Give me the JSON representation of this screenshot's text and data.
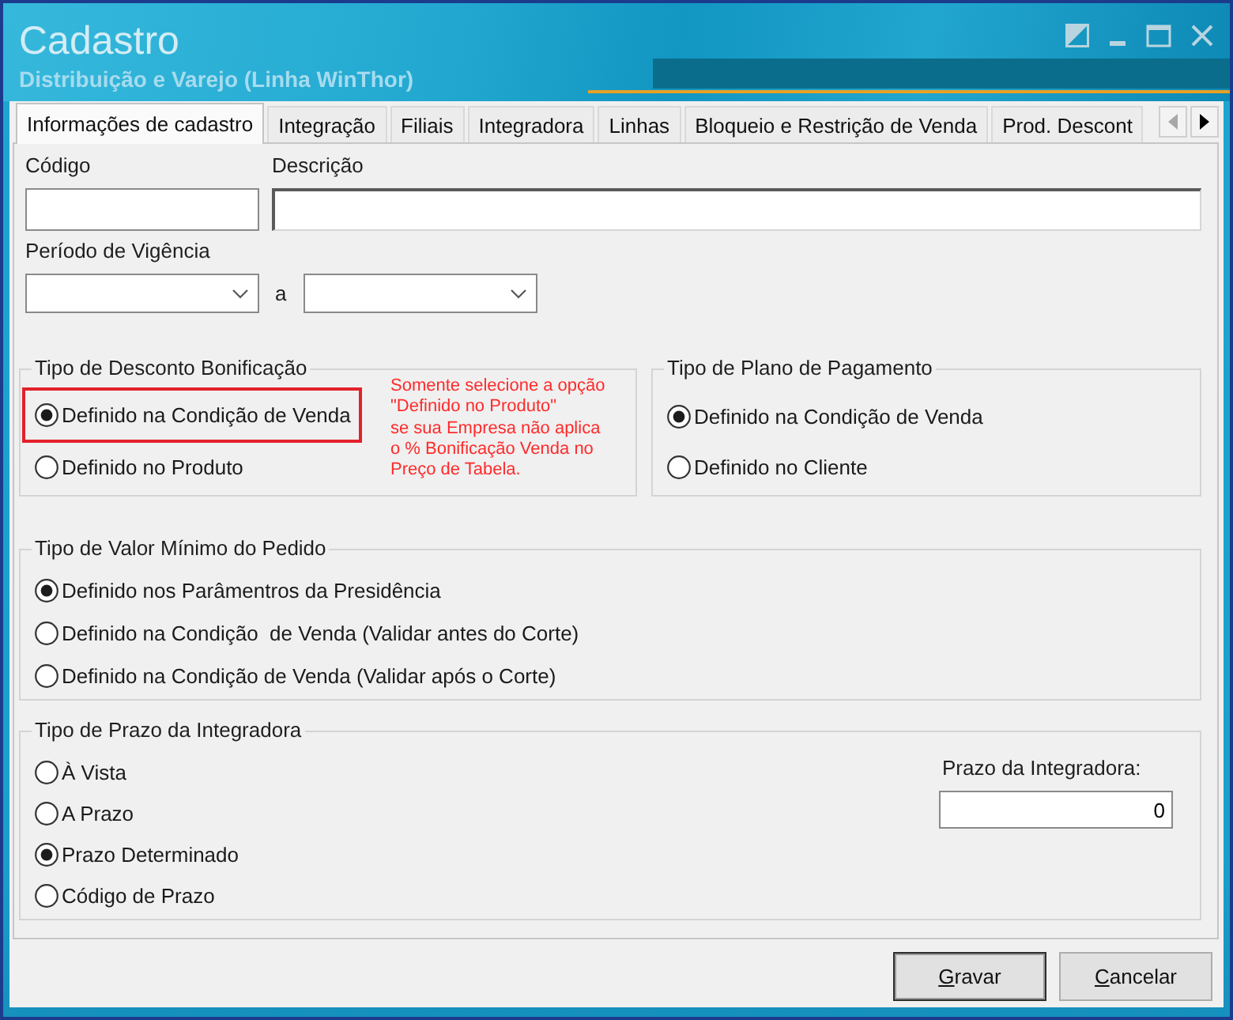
{
  "window": {
    "title": "Cadastro",
    "subtitle": "Distribuição e Varejo (Linha WinThor)"
  },
  "tabs": [
    {
      "label": "Informações de cadastro",
      "selected": true
    },
    {
      "label": "Integração",
      "selected": false
    },
    {
      "label": "Filiais",
      "selected": false
    },
    {
      "label": "Integradora",
      "selected": false
    },
    {
      "label": "Linhas",
      "selected": false
    },
    {
      "label": "Bloqueio e Restrição de Venda",
      "selected": false
    },
    {
      "label": "Prod. Descont",
      "selected": false
    }
  ],
  "tab_scroll": [
    {
      "kind": "left",
      "disabled": true
    },
    {
      "kind": "right",
      "disabled": false
    }
  ],
  "fields": {
    "code": {
      "label": "Código"
    },
    "description": {
      "label": "Descrição",
      "focused": true
    },
    "validity_period": {
      "label": "Período de Vigência",
      "separator": "a"
    }
  },
  "groups": [
    {
      "title": "Tipo de Desconto Bonificação",
      "options": [
        {
          "label": "Definido na Condição de Venda",
          "selected": true,
          "highlighted": true
        },
        {
          "label": "Definido no Produto",
          "selected": false,
          "highlighted": false
        }
      ],
      "note": "Somente selecione a opção\n\"Definido no Produto\"\nse sua Empresa não aplica\no % Bonificação Venda no\nPreço de Tabela."
    },
    {
      "title": "Tipo de Plano de Pagamento",
      "options": [
        {
          "label": "Definido na Condição de Venda",
          "selected": true,
          "highlighted": false
        },
        {
          "label": "Definido no Cliente",
          "selected": false,
          "highlighted": false
        }
      ]
    },
    {
      "title": "Tipo de Valor Mínimo do Pedido",
      "options": [
        {
          "label": "Definido nos Parâmentros da Presidência",
          "selected": true,
          "highlighted": false
        },
        {
          "label": "Definido na Condição  de Venda (Validar antes do Corte)",
          "selected": false,
          "highlighted": false
        },
        {
          "label": "Definido na Condição de Venda (Validar após o Corte)",
          "selected": false,
          "highlighted": false
        }
      ]
    },
    {
      "title": "Tipo de Prazo da Integradora",
      "options": [
        {
          "label": "À Vista",
          "selected": false,
          "highlighted": false
        },
        {
          "label": "A Prazo",
          "selected": false,
          "highlighted": false
        },
        {
          "label": "Prazo Determinado",
          "selected": true,
          "highlighted": false
        },
        {
          "label": "Código de Prazo",
          "selected": false,
          "highlighted": false
        }
      ],
      "field": {
        "label": "Prazo da Integradora:",
        "value": "0"
      }
    }
  ],
  "buttons": [
    {
      "label": "Gravar",
      "default": true
    },
    {
      "label": "Cancelar",
      "default": false
    }
  ]
}
